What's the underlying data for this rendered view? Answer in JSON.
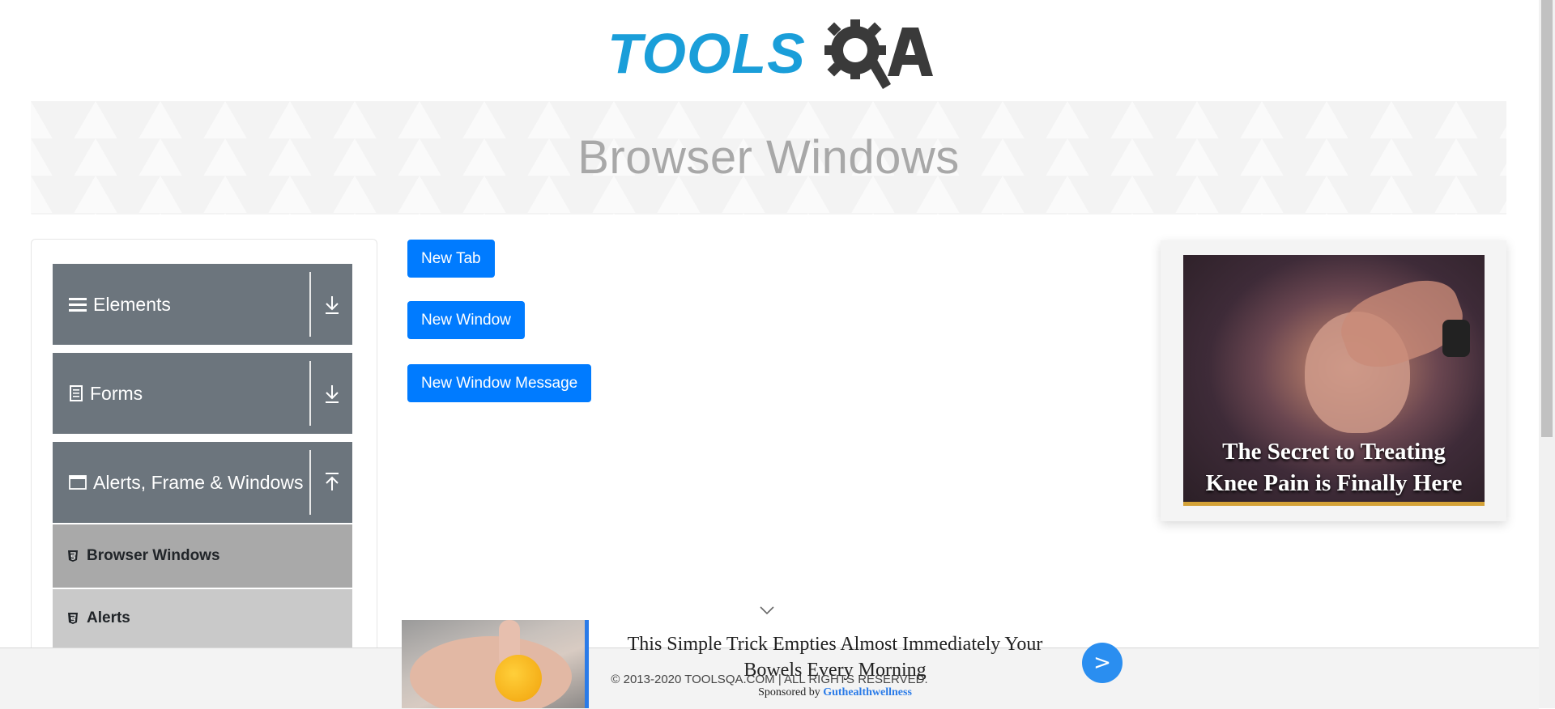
{
  "logo": {
    "text": "TOOLS",
    "suffix": "QA",
    "alt": "ToolsQA"
  },
  "banner": {
    "title": "Browser Windows"
  },
  "sidebar": {
    "groups": [
      {
        "label": "Elements",
        "icon": "hamburger-icon",
        "toggle_icon": "download-arrow-icon"
      },
      {
        "label": "Forms",
        "icon": "document-icon",
        "toggle_icon": "download-arrow-icon"
      },
      {
        "label": "Alerts, Frame & Windows",
        "icon": "window-icon",
        "toggle_icon": "upload-arrow-icon"
      }
    ],
    "subitems": [
      {
        "label": "Browser Windows",
        "icon": "html5-icon",
        "active": true
      },
      {
        "label": "Alerts",
        "icon": "html5-icon",
        "active": false
      }
    ]
  },
  "buttons": {
    "new_tab": "New Tab",
    "new_window": "New Window",
    "new_window_message": "New Window Message"
  },
  "right_ad": {
    "caption_line1": "The Secret to Treating",
    "caption_line2": "Knee Pain is Finally Here"
  },
  "bottom_ad": {
    "headline": "This Simple Trick Empties Almost Immediately Your Bowels Every Morning",
    "sponsor_prefix": "Sponsored by",
    "sponsor_name": "Guthealthwellness",
    "go_label": ">"
  },
  "footer": {
    "copyright": "© 2013-2020 TOOLSQA.COM | ALL RIGHTS RESERVED."
  },
  "colors": {
    "primary": "#007bff",
    "sidebar_group": "#6c757d",
    "active_item": "#a9a9a9",
    "inactive_item": "#c9c9c9",
    "logo_blue": "#1a9ed9",
    "logo_dark": "#3a3a3a"
  }
}
